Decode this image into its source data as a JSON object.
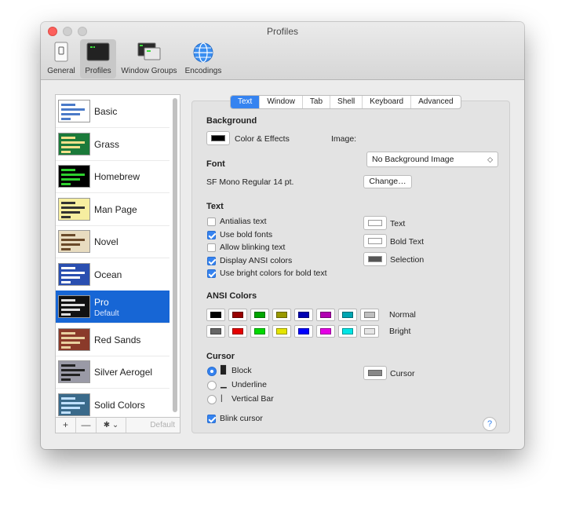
{
  "window": {
    "title": "Profiles"
  },
  "toolbar": {
    "items": [
      {
        "label": "General",
        "icon": "switch-icon"
      },
      {
        "label": "Profiles",
        "icon": "terminal-icon"
      },
      {
        "label": "Window Groups",
        "icon": "window-groups-icon"
      },
      {
        "label": "Encodings",
        "icon": "globe-icon"
      }
    ],
    "selected": "Profiles"
  },
  "sidebar": {
    "profiles": [
      {
        "name": "Basic",
        "thumb_bg": "#ffffff",
        "thumb_fg": "#4a7ac8"
      },
      {
        "name": "Grass",
        "thumb_bg": "#1b7a3a",
        "thumb_fg": "#f2e08a"
      },
      {
        "name": "Homebrew",
        "thumb_bg": "#000000",
        "thumb_fg": "#2fd02f"
      },
      {
        "name": "Man Page",
        "thumb_bg": "#f6eea0",
        "thumb_fg": "#333333"
      },
      {
        "name": "Novel",
        "thumb_bg": "#e8dcc0",
        "thumb_fg": "#6a4a2a"
      },
      {
        "name": "Ocean",
        "thumb_bg": "#2a4fb0",
        "thumb_fg": "#ffffff"
      },
      {
        "name": "Pro",
        "sub": "Default",
        "thumb_bg": "#111111",
        "thumb_fg": "#dddddd"
      },
      {
        "name": "Red Sands",
        "thumb_bg": "#8a3a2a",
        "thumb_fg": "#e8d0a0"
      },
      {
        "name": "Silver Aerogel",
        "thumb_bg": "#9a9aa6",
        "thumb_fg": "#222222"
      },
      {
        "name": "Solid Colors",
        "thumb_bg": "#3a6a8a",
        "thumb_fg": "#c0e0ff"
      }
    ],
    "selected": "Pro",
    "footer": {
      "add": "+",
      "remove": "—",
      "gear": "✱ ⌄",
      "default": "Default"
    }
  },
  "tabs": [
    "Text",
    "Window",
    "Tab",
    "Shell",
    "Keyboard",
    "Advanced"
  ],
  "active_tab": "Text",
  "background": {
    "title": "Background",
    "color_label": "Color & Effects",
    "image_label": "Image:",
    "image_value": "No Background Image"
  },
  "font": {
    "title": "Font",
    "value": "SF Mono Regular 14 pt.",
    "change_label": "Change…"
  },
  "text": {
    "title": "Text",
    "options": [
      {
        "label": "Antialias text",
        "checked": false
      },
      {
        "label": "Use bold fonts",
        "checked": true
      },
      {
        "label": "Allow blinking text",
        "checked": false
      },
      {
        "label": "Display ANSI colors",
        "checked": true
      },
      {
        "label": "Use bright colors for bold text",
        "checked": true
      }
    ],
    "colors": [
      {
        "label": "Text",
        "color": "#ffffff"
      },
      {
        "label": "Bold Text",
        "color": "#ffffff"
      },
      {
        "label": "Selection",
        "color": "#555555"
      }
    ]
  },
  "ansi": {
    "title": "ANSI Colors",
    "normal_label": "Normal",
    "bright_label": "Bright",
    "normal": [
      "#000000",
      "#990000",
      "#00a600",
      "#999900",
      "#0000b2",
      "#b200b2",
      "#00a6b2",
      "#bfbfbf"
    ],
    "bright": [
      "#666666",
      "#e50000",
      "#00d900",
      "#e5e500",
      "#0000ff",
      "#e500e5",
      "#00e5e5",
      "#e5e5e5"
    ]
  },
  "cursor": {
    "title": "Cursor",
    "options": [
      {
        "label": "Block",
        "glyph": "█",
        "selected": true
      },
      {
        "label": "Underline",
        "glyph": "▁",
        "selected": false
      },
      {
        "label": "Vertical Bar",
        "glyph": "|",
        "selected": false
      }
    ],
    "blink_label": "Blink cursor",
    "blink": true,
    "color_label": "Cursor",
    "color": "#888888"
  },
  "help": "?"
}
